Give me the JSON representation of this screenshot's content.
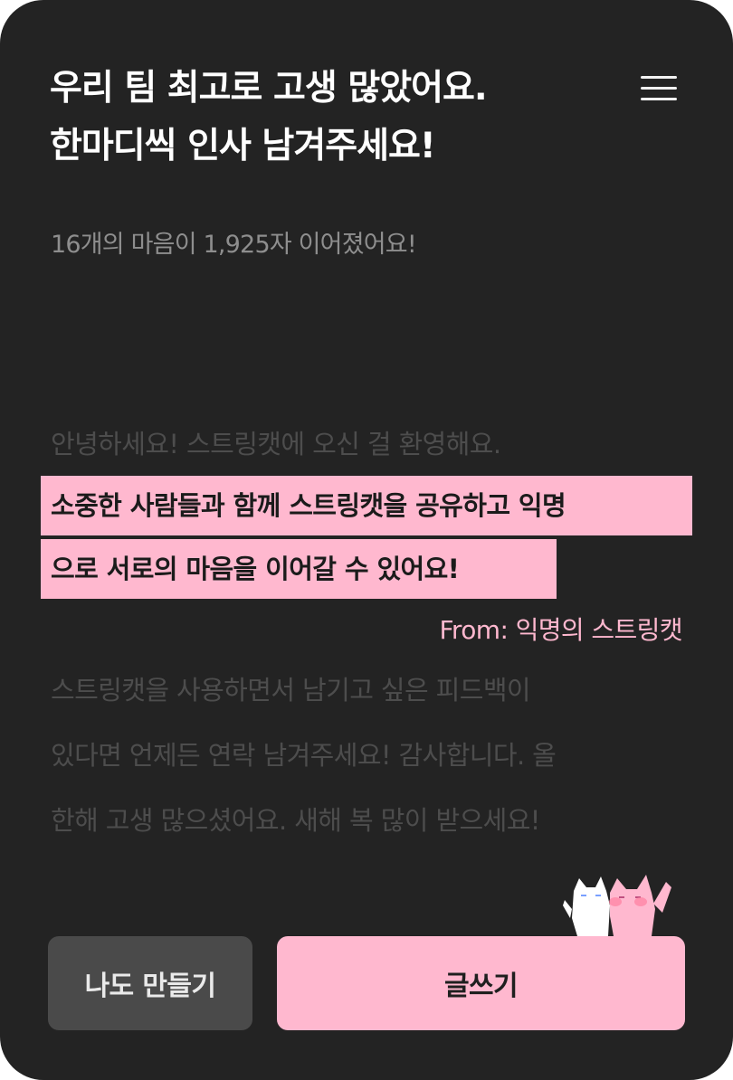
{
  "header": {
    "title_line1": "우리 팀 최고로 고생 많았어요.",
    "title_line2": "한마디씩 인사 남겨주세요!",
    "menu_icon": "hamburger-menu-icon"
  },
  "summary": {
    "text": "16개의 마음이 1,925자 이어졌어요!"
  },
  "message": {
    "faded_before": "안녕하세요! 스트링캣에 오신 걸 환영해요.",
    "highlighted_line1": "소중한 사람들과 함께 스트링캣을 공유하고 익명",
    "highlighted_line2": "으로 서로의 마음을 이어갈 수 있어요!",
    "from": "From: 익명의 스트링캣",
    "faded_after_line1": "스트링캣을  사용하면서  남기고  싶은  피드백이",
    "faded_after_line2": "있다면 언제든 연락 남겨주세요! 감사합니다. 올",
    "faded_after_line3": "한해 고생 많으셨어요. 새해 복 많이 받으세요!"
  },
  "actions": {
    "make_mine_label": "나도 만들기",
    "write_label": "글쓰기"
  },
  "decoration": {
    "icon": "cat-pair-icon"
  },
  "colors": {
    "background": "#232323",
    "accent": "#ffb8cf",
    "secondary_button": "#4a4a4a"
  }
}
